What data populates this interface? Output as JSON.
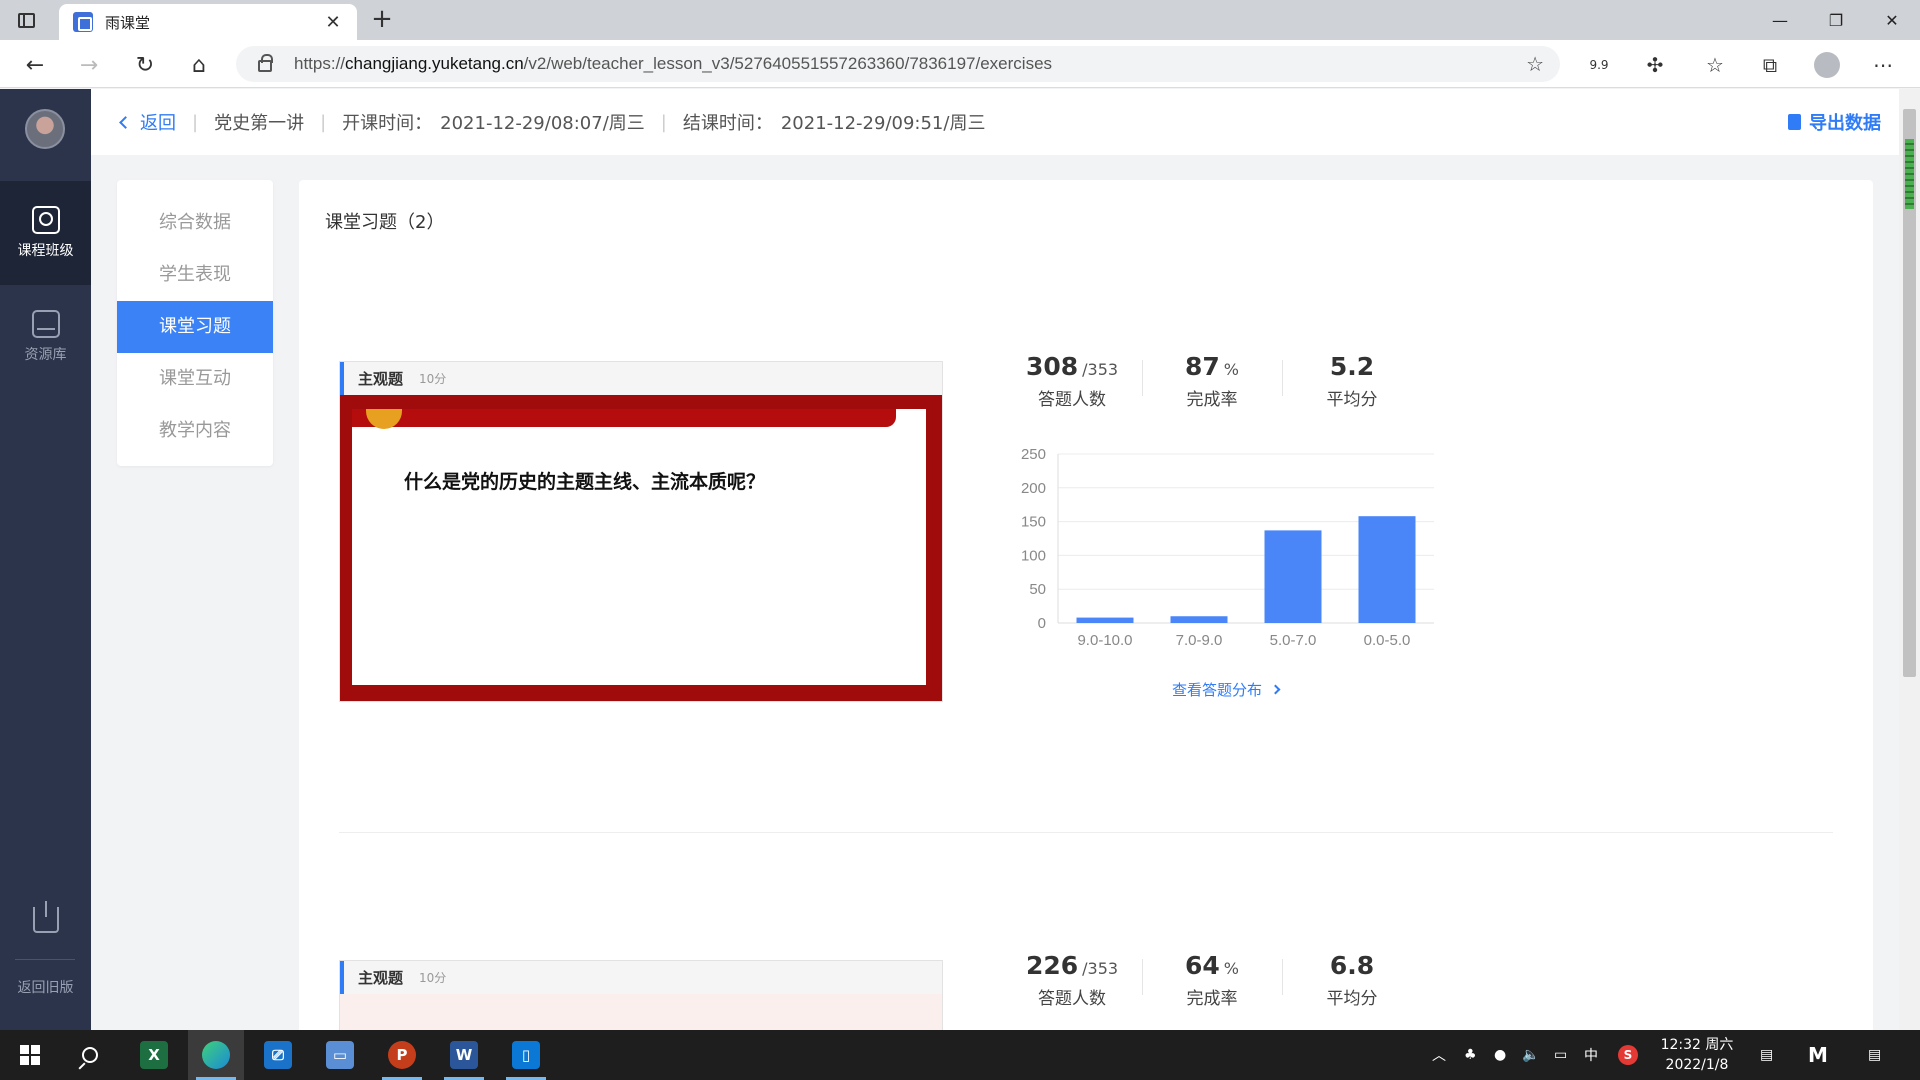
{
  "browser": {
    "tab_title": "雨课堂",
    "url_prefix": "https://",
    "url_host": "changjiang.yuketang.cn",
    "url_path": "/v2/web/teacher_lesson_v3/527640551557263360/7836197/exercises",
    "ext_label": "9.9"
  },
  "leftnav": {
    "items": [
      {
        "label": "课程班级",
        "active": true
      },
      {
        "label": "资源库",
        "active": false
      }
    ],
    "bottom_label": "返回旧版"
  },
  "header": {
    "back_label": "返回",
    "lesson_title": "党史第一讲",
    "start_label": "开课时间：",
    "start_value": "2021-12-29/08:07/周三",
    "end_label": "结课时间：",
    "end_value": "2021-12-29/09:51/周三",
    "export_label": "导出数据"
  },
  "subnav": {
    "items": [
      "综合数据",
      "学生表现",
      "课堂习题",
      "课堂互动",
      "教学内容"
    ],
    "active_index": 2
  },
  "main": {
    "title": "课堂习题（2）",
    "exercises": [
      {
        "type": "主观题",
        "score": "10分",
        "question": "什么是党的历史的主题主线、主流本质呢？",
        "answered": "308",
        "total": "/353",
        "answered_label": "答题人数",
        "completion": "87",
        "completion_unit": "%",
        "completion_label": "完成率",
        "avg": "5.2",
        "avg_label": "平均分",
        "link_label": "查看答题分布"
      },
      {
        "type": "主观题",
        "score": "10分",
        "answered": "226",
        "total": "/353",
        "answered_label": "答题人数",
        "completion": "64",
        "completion_unit": "%",
        "completion_label": "完成率",
        "avg": "6.8",
        "avg_label": "平均分"
      }
    ]
  },
  "chart_data": {
    "type": "bar",
    "categories": [
      "9.0-10.0",
      "7.0-9.0",
      "5.0-7.0",
      "0.0-5.0"
    ],
    "values": [
      8,
      10,
      137,
      158
    ],
    "ylim": [
      0,
      250
    ],
    "yticks": [
      0,
      50,
      100,
      150,
      200,
      250
    ],
    "grid": true,
    "color": "#4a86f7"
  },
  "taskbar": {
    "time": "12:32 周六",
    "date": "2022/1/8",
    "ime": "中"
  }
}
